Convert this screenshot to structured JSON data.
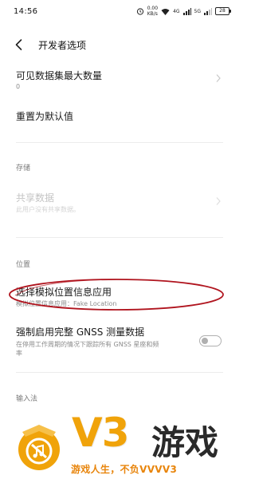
{
  "status_bar": {
    "time": "14:56",
    "speed_value": "0.00",
    "speed_unit": "KB/s",
    "net_type": "4G",
    "net_type2": "5G",
    "battery": "28"
  },
  "header": {
    "title": "开发者选项"
  },
  "rows": {
    "max_datasets": {
      "title": "可见数据集最大数量",
      "value": "0"
    },
    "reset_defaults": {
      "title": "重置为默认值"
    },
    "shared_data": {
      "title": "共享数据",
      "subtitle": "此用户没有共享数据。"
    },
    "mock_location": {
      "title": "选择模拟位置信息应用",
      "subtitle": "模拟位置信息应用：Fake Location"
    },
    "gnss": {
      "title": "强制启用完整 GNSS 测量数据",
      "subtitle_line1": "在停用工作周期的情况下跟踪所有 GNSS 星座和频",
      "subtitle_line2": "率",
      "enabled": false
    }
  },
  "sections": {
    "storage": "存储",
    "location": "位置",
    "input_method": "输入法"
  },
  "watermark": {
    "brand": "V3",
    "brand_cn": "游戏",
    "tagline": "游戏人生，不负VVVV3"
  },
  "colors": {
    "annotation": "#b0141e",
    "watermark_orange": "#f0a30a"
  }
}
